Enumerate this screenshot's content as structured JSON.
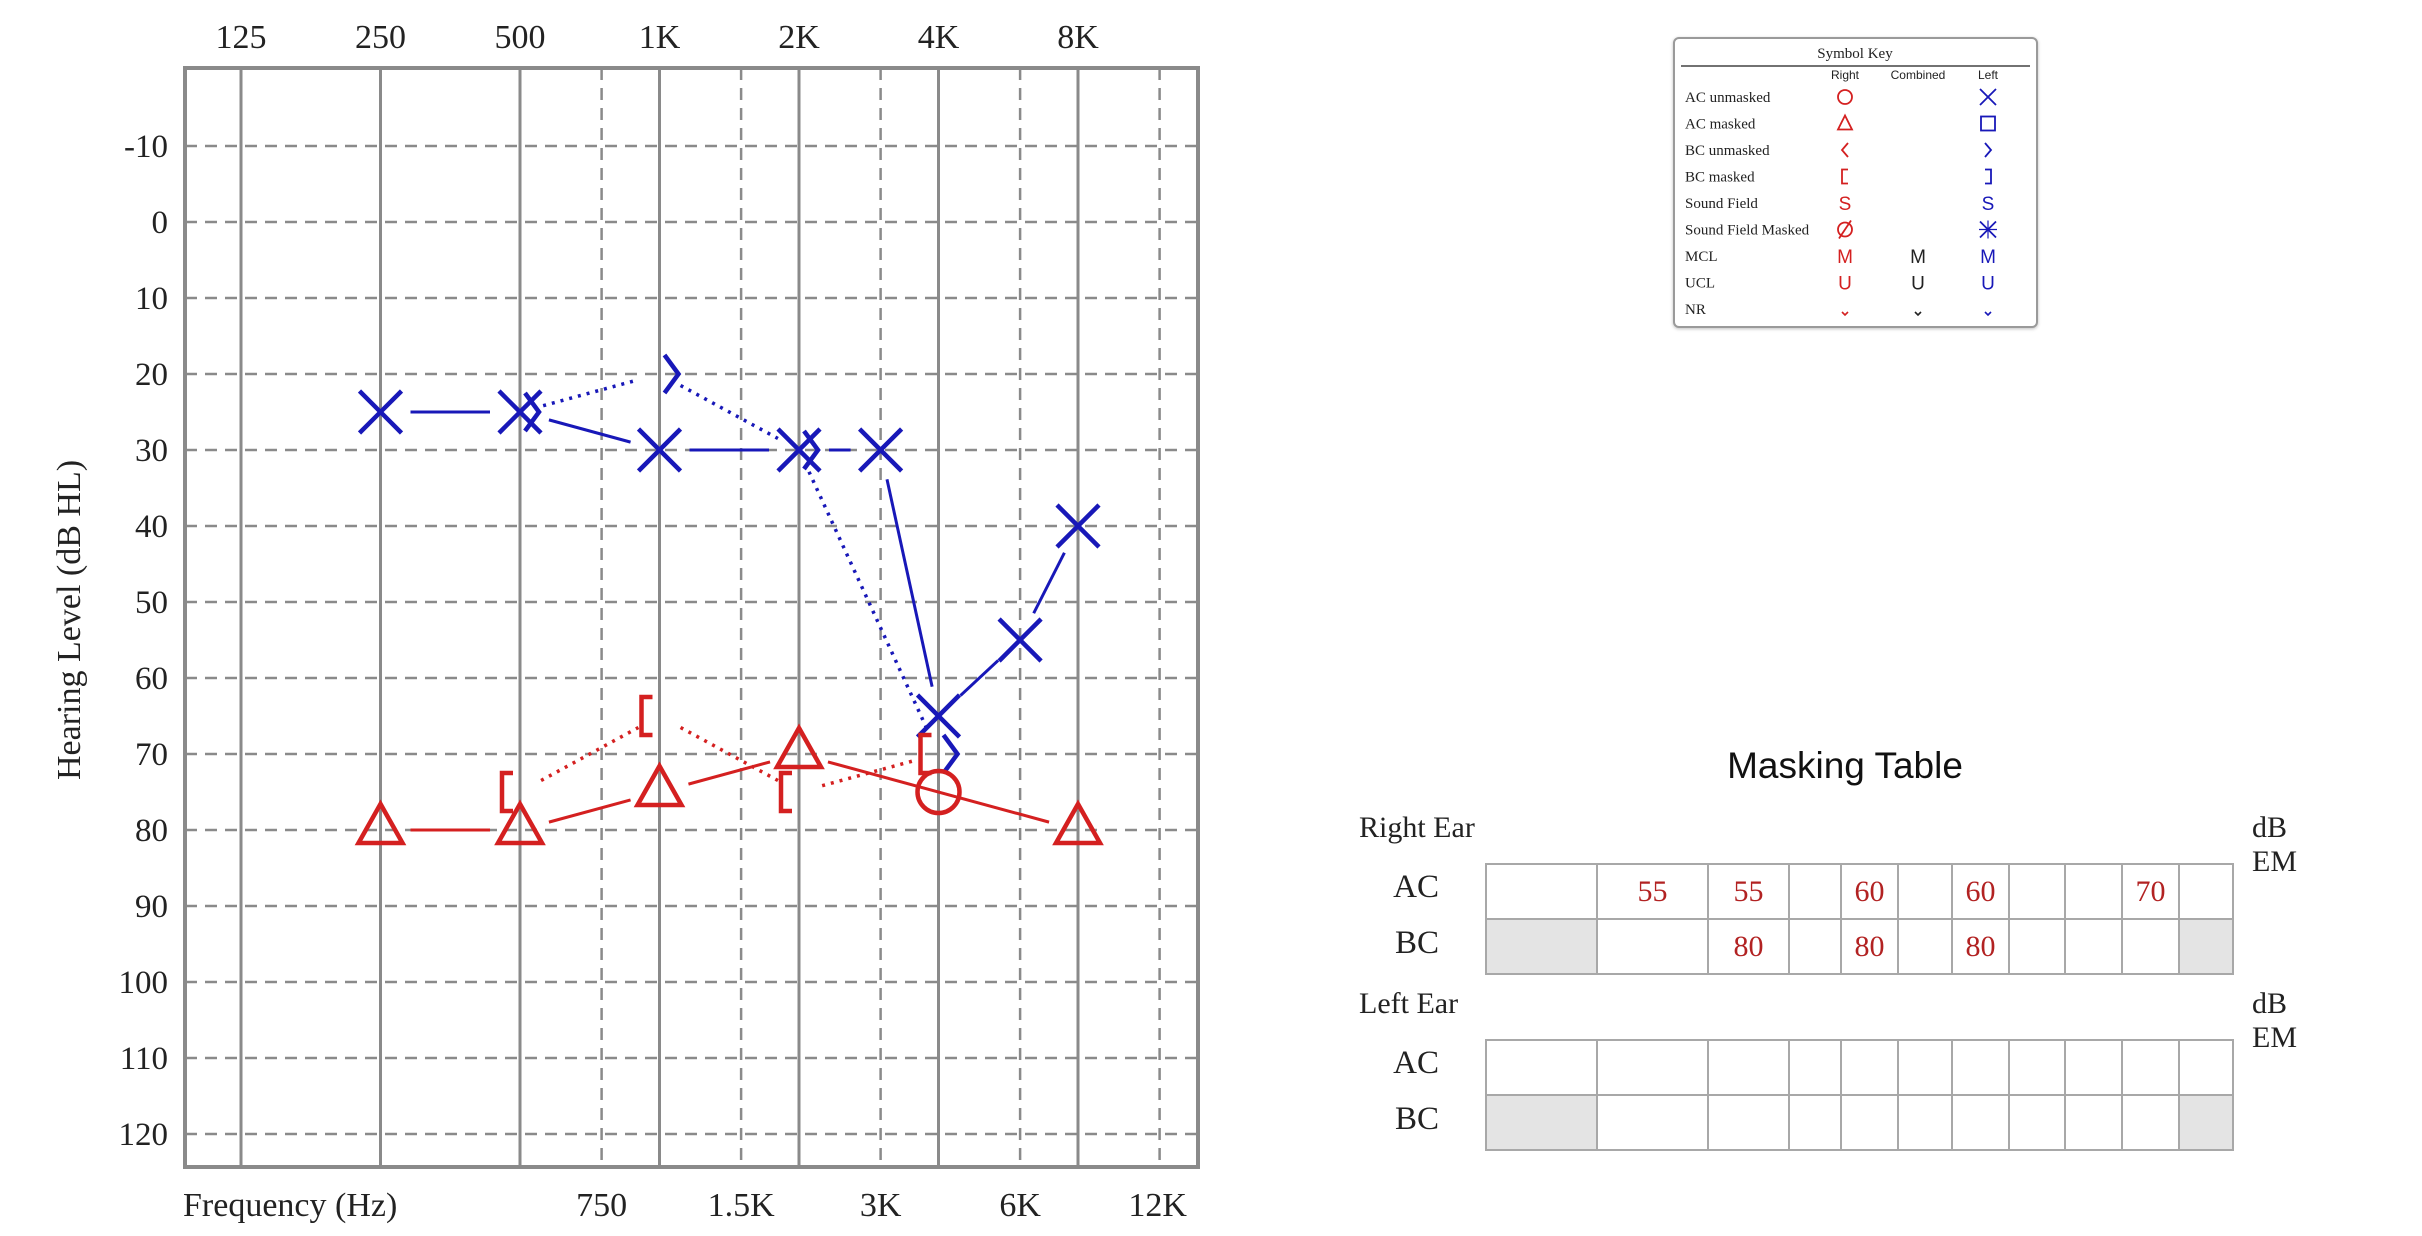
{
  "chart_data": {
    "type": "audiogram",
    "xlabel": "Frequency (Hz)",
    "ylabel": "Hearing Level (dB HL)",
    "top_frequency_labels": [
      "125",
      "250",
      "500",
      "1K",
      "2K",
      "4K",
      "8K"
    ],
    "bottom_frequency_labels": [
      "750",
      "1.5K",
      "3K",
      "6K",
      "12K"
    ],
    "y_ticks": [
      "-10",
      "0",
      "10",
      "20",
      "30",
      "40",
      "50",
      "60",
      "70",
      "80",
      "90",
      "100",
      "110",
      "120"
    ],
    "ylim": [
      -20,
      125
    ],
    "x_scale": "log",
    "colors": {
      "right": "#d42020",
      "left": "#1818b8"
    },
    "series": [
      {
        "name": "AC unmasked",
        "ear": "left",
        "line": "solid",
        "points": [
          {
            "freq": 250,
            "db": 25
          },
          {
            "freq": 500,
            "db": 25
          },
          {
            "freq": 1000,
            "db": 30
          },
          {
            "freq": 2000,
            "db": 30
          },
          {
            "freq": 3000,
            "db": 30
          },
          {
            "freq": 4000,
            "db": 65
          },
          {
            "freq": 6000,
            "db": 55
          },
          {
            "freq": 8000,
            "db": 40
          }
        ]
      },
      {
        "name": "BC unmasked",
        "ear": "left",
        "line": "dotted",
        "points": [
          {
            "freq": 500,
            "db": 25
          },
          {
            "freq": 1000,
            "db": 20
          },
          {
            "freq": 2000,
            "db": 30
          },
          {
            "freq": 4000,
            "db": 70
          }
        ]
      },
      {
        "name": "AC masked",
        "ear": "right",
        "line": "solid",
        "points": [
          {
            "freq": 250,
            "db": 80
          },
          {
            "freq": 500,
            "db": 80
          },
          {
            "freq": 1000,
            "db": 75
          },
          {
            "freq": 2000,
            "db": 70
          },
          {
            "freq": 8000,
            "db": 80
          }
        ]
      },
      {
        "name": "AC unmasked",
        "ear": "right",
        "line": "solid",
        "points": [
          {
            "freq": 4000,
            "db": 75
          }
        ]
      },
      {
        "name": "BC masked",
        "ear": "right",
        "line": "dotted",
        "points": [
          {
            "freq": 500,
            "db": 75
          },
          {
            "freq": 1000,
            "db": 65
          },
          {
            "freq": 2000,
            "db": 75
          },
          {
            "freq": 4000,
            "db": 70
          }
        ]
      }
    ]
  },
  "symbol_key": {
    "title": "Symbol Key",
    "columns": [
      "Right",
      "Combined",
      "Left"
    ],
    "rows": [
      {
        "label": "AC unmasked",
        "right": "circle",
        "combined": "",
        "left": "x"
      },
      {
        "label": "AC masked",
        "right": "triangle",
        "combined": "",
        "left": "square"
      },
      {
        "label": "BC unmasked",
        "right": "<",
        "combined": "",
        "left": ">"
      },
      {
        "label": "BC masked",
        "right": "[",
        "combined": "",
        "left": "]"
      },
      {
        "label": "Sound Field",
        "right": "S",
        "combined": "",
        "left": "S"
      },
      {
        "label": "Sound Field Masked",
        "right": "slashed-circle",
        "combined": "",
        "left": "starred-x"
      },
      {
        "label": "MCL",
        "right": "M",
        "combined": "M",
        "left": "M"
      },
      {
        "label": "UCL",
        "right": "U",
        "combined": "U",
        "left": "U"
      },
      {
        "label": "NR",
        "right": "nr-arrow",
        "combined": "nr-arrow",
        "left": "nr-arrow"
      }
    ]
  },
  "masking_table": {
    "title": "Masking Table",
    "unit": "dB EM",
    "right_ear": {
      "label": "Right Ear",
      "ac_label": "AC",
      "bc_label": "BC",
      "ac": [
        "",
        "55",
        "55",
        "",
        "60",
        "",
        "60",
        "",
        "",
        "70",
        ""
      ],
      "bc": [
        "",
        "",
        "80",
        "",
        "80",
        "",
        "80",
        "",
        "",
        "",
        ""
      ]
    },
    "left_ear": {
      "label": "Left Ear",
      "ac_label": "AC",
      "bc_label": "BC",
      "ac": [
        "",
        "",
        "",
        "",
        "",
        "",
        "",
        "",
        "",
        "",
        ""
      ],
      "bc": [
        "",
        "",
        "",
        "",
        "",
        "",
        "",
        "",
        "",
        "",
        ""
      ]
    }
  }
}
